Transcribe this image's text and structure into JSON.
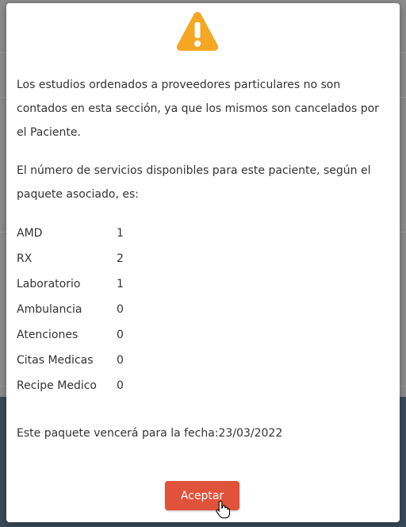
{
  "modal": {
    "icon": "warning-triangle-icon",
    "icon_color": "#f5a623",
    "paragraph1": "Los estudios ordenados a proveedores particulares no son contados en esta sección, ya que los mismos son cancelados por el Paciente.",
    "paragraph2": "El número de servicios disponibles para este paciente, según el paquete asociado, es:",
    "services": [
      {
        "name": "AMD",
        "count": "1"
      },
      {
        "name": "RX",
        "count": "2"
      },
      {
        "name": "Laboratorio",
        "count": "1"
      },
      {
        "name": "Ambulancia",
        "count": "0"
      },
      {
        "name": "Atenciones",
        "count": "0"
      },
      {
        "name": "Citas Medicas",
        "count": "0"
      },
      {
        "name": "Recipe Medico",
        "count": "0"
      }
    ],
    "expiry_text": "Este paquete vencerá para la fecha:23/03/2022",
    "accept_label": "Aceptar",
    "accept_color": "#e0523a"
  }
}
